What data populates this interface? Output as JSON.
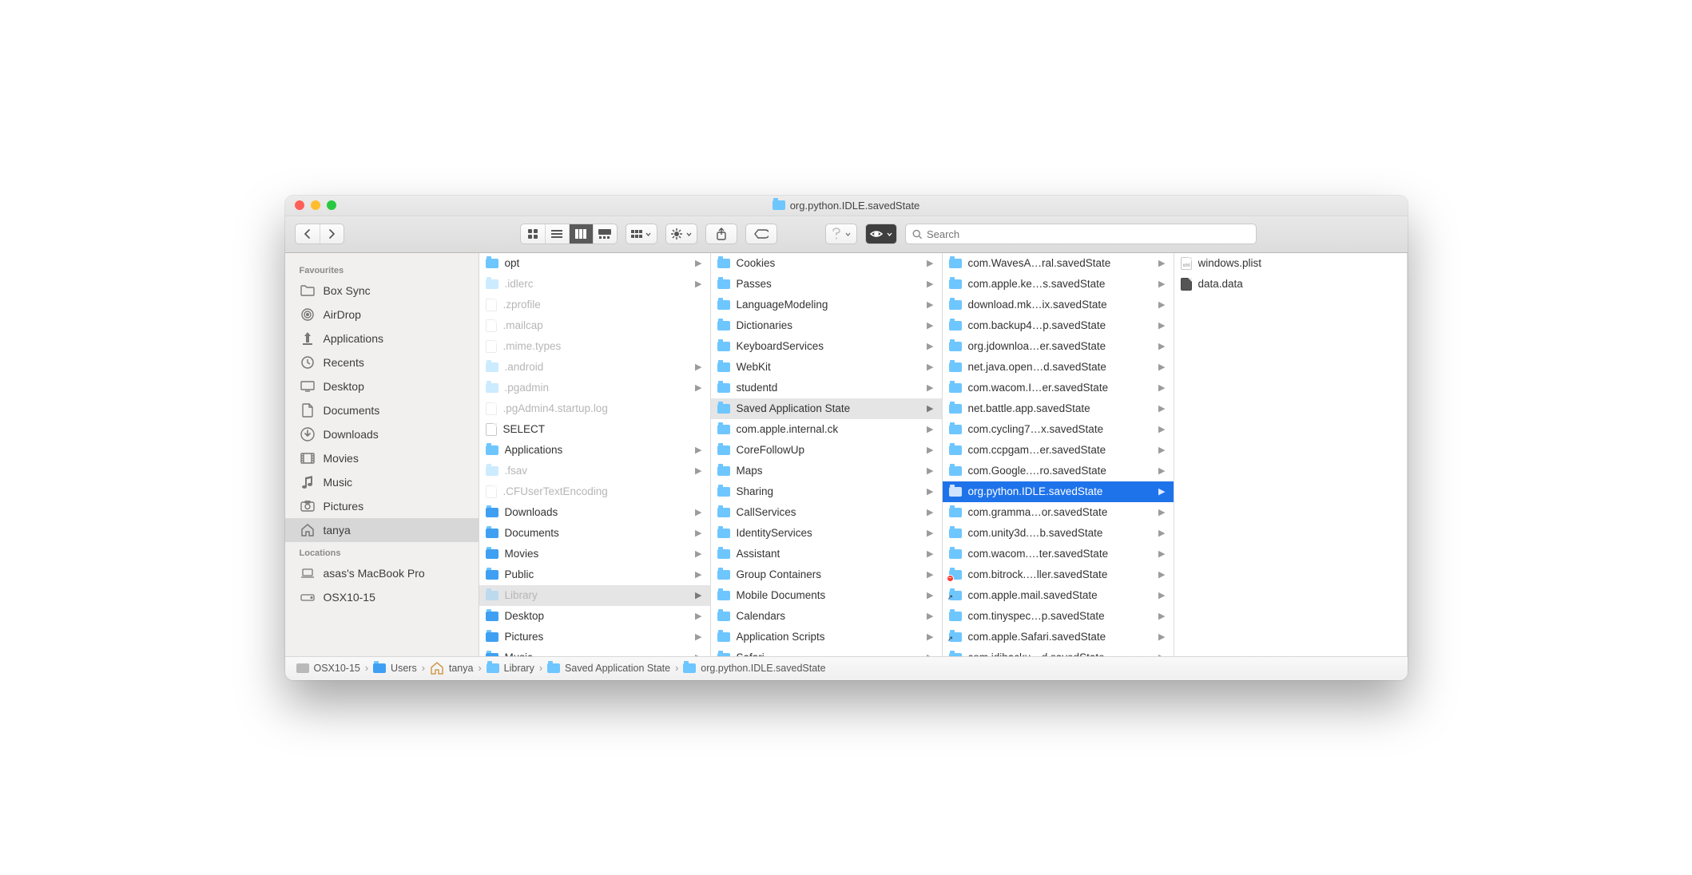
{
  "window_title": "org.python.IDLE.savedState",
  "search": {
    "placeholder": "Search"
  },
  "sidebar": {
    "sections": [
      {
        "title": "Favourites",
        "items": [
          {
            "label": "Box Sync",
            "icon": "folder"
          },
          {
            "label": "AirDrop",
            "icon": "airdrop"
          },
          {
            "label": "Applications",
            "icon": "apps"
          },
          {
            "label": "Recents",
            "icon": "recents"
          },
          {
            "label": "Desktop",
            "icon": "desktop"
          },
          {
            "label": "Documents",
            "icon": "documents"
          },
          {
            "label": "Downloads",
            "icon": "downloads"
          },
          {
            "label": "Movies",
            "icon": "movies"
          },
          {
            "label": "Music",
            "icon": "music"
          },
          {
            "label": "Pictures",
            "icon": "pictures"
          },
          {
            "label": "tanya",
            "icon": "home",
            "selected": true
          }
        ]
      },
      {
        "title": "Locations",
        "items": [
          {
            "label": "asas's MacBook Pro",
            "icon": "laptop"
          },
          {
            "label": "OSX10-15",
            "icon": "hdd"
          }
        ]
      }
    ]
  },
  "columns": [
    [
      {
        "label": "opt",
        "type": "folder",
        "expandable": true
      },
      {
        "label": ".idlerc",
        "type": "folder",
        "expandable": true,
        "hidden": true
      },
      {
        "label": ".zprofile",
        "type": "file",
        "hidden": true
      },
      {
        "label": ".mailcap",
        "type": "file",
        "hidden": true
      },
      {
        "label": ".mime.types",
        "type": "file",
        "hidden": true
      },
      {
        "label": ".android",
        "type": "folder",
        "expandable": true,
        "hidden": true
      },
      {
        "label": ".pgadmin",
        "type": "folder",
        "expandable": true,
        "hidden": true
      },
      {
        "label": ".pgAdmin4.startup.log",
        "type": "file",
        "hidden": true,
        "ext": "log"
      },
      {
        "label": "SELECT",
        "type": "file"
      },
      {
        "label": "Applications",
        "type": "folder",
        "expandable": true
      },
      {
        "label": ".fsav",
        "type": "folder",
        "expandable": true,
        "hidden": true
      },
      {
        "label": ".CFUserTextEncoding",
        "type": "file",
        "hidden": true
      },
      {
        "label": "Downloads",
        "type": "bluefolder",
        "expandable": true
      },
      {
        "label": "Documents",
        "type": "bluefolder",
        "expandable": true
      },
      {
        "label": "Movies",
        "type": "bluefolder",
        "expandable": true
      },
      {
        "label": "Public",
        "type": "bluefolder",
        "expandable": true
      },
      {
        "label": "Library",
        "type": "folder",
        "expandable": true,
        "hidden": true,
        "selpath": true
      },
      {
        "label": "Desktop",
        "type": "bluefolder",
        "expandable": true
      },
      {
        "label": "Pictures",
        "type": "bluefolder",
        "expandable": true
      },
      {
        "label": "Music",
        "type": "bluefolder",
        "expandable": true
      }
    ],
    [
      {
        "label": "Cookies",
        "type": "folder",
        "expandable": true
      },
      {
        "label": "Passes",
        "type": "folder",
        "expandable": true
      },
      {
        "label": "LanguageModeling",
        "type": "folder",
        "expandable": true
      },
      {
        "label": "Dictionaries",
        "type": "folder",
        "expandable": true
      },
      {
        "label": "KeyboardServices",
        "type": "folder",
        "expandable": true
      },
      {
        "label": "WebKit",
        "type": "folder",
        "expandable": true
      },
      {
        "label": "studentd",
        "type": "folder",
        "expandable": true
      },
      {
        "label": "Saved Application State",
        "type": "folder",
        "expandable": true,
        "selpath": true
      },
      {
        "label": "com.apple.internal.ck",
        "type": "folder",
        "expandable": true
      },
      {
        "label": "CoreFollowUp",
        "type": "folder",
        "expandable": true
      },
      {
        "label": "Maps",
        "type": "folder",
        "expandable": true
      },
      {
        "label": "Sharing",
        "type": "folder",
        "expandable": true
      },
      {
        "label": "CallServices",
        "type": "folder",
        "expandable": true
      },
      {
        "label": "IdentityServices",
        "type": "folder",
        "expandable": true
      },
      {
        "label": "Assistant",
        "type": "folder",
        "expandable": true
      },
      {
        "label": "Group Containers",
        "type": "folder",
        "expandable": true
      },
      {
        "label": "Mobile Documents",
        "type": "folder",
        "expandable": true
      },
      {
        "label": "Calendars",
        "type": "folder",
        "expandable": true
      },
      {
        "label": "Application Scripts",
        "type": "folder",
        "expandable": true
      },
      {
        "label": "Safari",
        "type": "folder",
        "expandable": true
      }
    ],
    [
      {
        "label": "com.WavesA…ral.savedState",
        "type": "folder",
        "expandable": true
      },
      {
        "label": "com.apple.ke…s.savedState",
        "type": "folder",
        "expandable": true
      },
      {
        "label": "download.mk…ix.savedState",
        "type": "folder",
        "expandable": true
      },
      {
        "label": "com.backup4…p.savedState",
        "type": "folder",
        "expandable": true
      },
      {
        "label": "org.jdownloa…er.savedState",
        "type": "folder",
        "expandable": true
      },
      {
        "label": "net.java.open…d.savedState",
        "type": "folder",
        "expandable": true
      },
      {
        "label": "com.wacom.I…er.savedState",
        "type": "folder",
        "expandable": true
      },
      {
        "label": "net.battle.app.savedState",
        "type": "folder",
        "expandable": true
      },
      {
        "label": "com.cycling7…x.savedState",
        "type": "folder",
        "expandable": true
      },
      {
        "label": "com.ccpgam…er.savedState",
        "type": "folder",
        "expandable": true
      },
      {
        "label": "com.Google.…ro.savedState",
        "type": "folder",
        "expandable": true
      },
      {
        "label": "org.python.IDLE.savedState",
        "type": "folder",
        "expandable": true,
        "active": true
      },
      {
        "label": "com.gramma…or.savedState",
        "type": "folder",
        "expandable": true
      },
      {
        "label": "com.unity3d.…b.savedState",
        "type": "folder",
        "expandable": true
      },
      {
        "label": "com.wacom.…ter.savedState",
        "type": "folder",
        "expandable": true
      },
      {
        "label": "com.bitrock.…ller.savedState",
        "type": "folder",
        "expandable": true,
        "blocked": true
      },
      {
        "label": "com.apple.mail.savedState",
        "type": "alias",
        "expandable": true
      },
      {
        "label": "com.tinyspec…p.savedState",
        "type": "folder",
        "expandable": true
      },
      {
        "label": "com.apple.Safari.savedState",
        "type": "alias",
        "expandable": true
      },
      {
        "label": "com.idibacku…d.savedState",
        "type": "folder",
        "expandable": true
      }
    ],
    [
      {
        "label": "windows.plist",
        "type": "plist"
      },
      {
        "label": "data.data",
        "type": "binfile"
      }
    ]
  ],
  "path": [
    {
      "label": "OSX10-15",
      "icon": "hdd"
    },
    {
      "label": "Users",
      "icon": "bluefolder"
    },
    {
      "label": "tanya",
      "icon": "home"
    },
    {
      "label": "Library",
      "icon": "folder"
    },
    {
      "label": "Saved Application State",
      "icon": "folder"
    },
    {
      "label": "org.python.IDLE.savedState",
      "icon": "folder"
    }
  ]
}
